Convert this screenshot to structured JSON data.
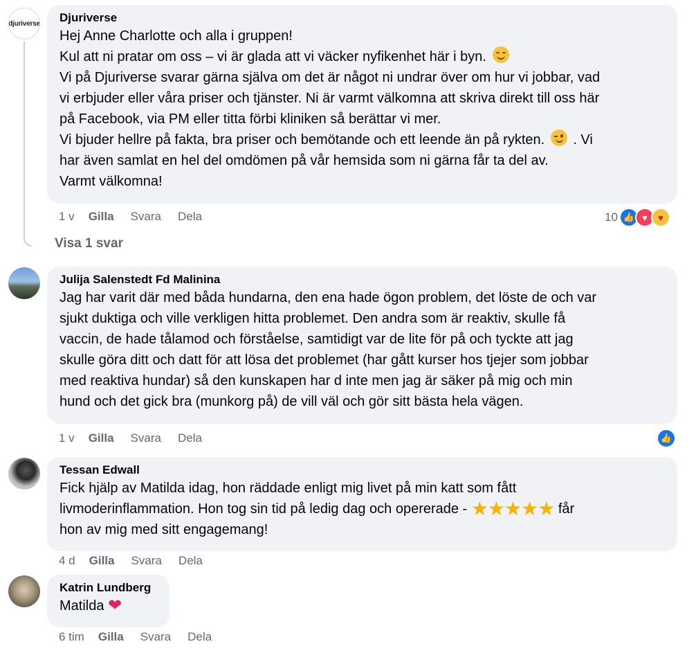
{
  "comments": [
    {
      "author": "Djuriverse",
      "avatar_text": "djuriverse",
      "lines": [
        "Hej Anne Charlotte och alla i gruppen!",
        "Kul att ni pratar om oss – vi är glada att vi väcker nyfikenhet här i byn.",
        "Vi på Djuriverse svarar gärna själva om det är något ni undrar över om hur vi jobbar, vad",
        "vi erbjuder eller våra priser och tjänster. Ni är varmt välkomna att skriva direkt till oss här",
        "på Facebook, via PM eller titta förbi kliniken så berättar vi mer.",
        "Vi bjuder hellre på fakta, bra priser och bemötande och ett leende än på rykten.",
        ". Vi",
        "har även samlat en hel del omdömen på vår hemsida som ni gärna får ta del av.",
        "Varmt välkomna!"
      ],
      "time": "1 v",
      "like": "Gilla",
      "reply": "Svara",
      "share": "Dela",
      "reaction_count": "10",
      "view_replies": "Visa 1 svar"
    },
    {
      "author": "Julija Salenstedt Fd Malinina",
      "lines": [
        "Jag har varit där med båda hundarna, den ena hade ögon problem, det löste de och var",
        "sjukt duktiga och ville verkligen hitta problemet. Den andra som är reaktiv, skulle få",
        "vaccin, de hade tålamod och förståelse, samtidigt var de lite för på och tyckte att jag",
        "skulle göra ditt och datt för att lösa det problemet (har gått kurser hos tjejer som jobbar",
        "med reaktiva hundar) så den kunskapen har d inte men jag är säker på mig och min",
        "hund och det gick bra (munkorg på) de vill väl och gör sitt bästa hela vägen."
      ],
      "time": "1 v",
      "like": "Gilla",
      "reply": "Svara",
      "share": "Dela"
    },
    {
      "author": "Tessan Edwall",
      "lines": [
        "Fick hjälp av Matilda idag, hon räddade enligt mig livet på min katt som fått",
        "livmoderinflammation. Hon tog sin tid på ledig dag och opererade -",
        "får",
        "hon av mig med sitt engagemang!"
      ],
      "stars": "★★★★★",
      "time": "4 d",
      "like": "Gilla",
      "reply": "Svara",
      "share": "Dela"
    },
    {
      "author": "Katrin Lundberg",
      "text": "Matilda",
      "heart": "❤",
      "time": "6 tim",
      "like": "Gilla",
      "reply": "Svara",
      "share": "Dela"
    }
  ],
  "icons": {
    "like": "👍",
    "love": "♥",
    "care": "♥"
  }
}
